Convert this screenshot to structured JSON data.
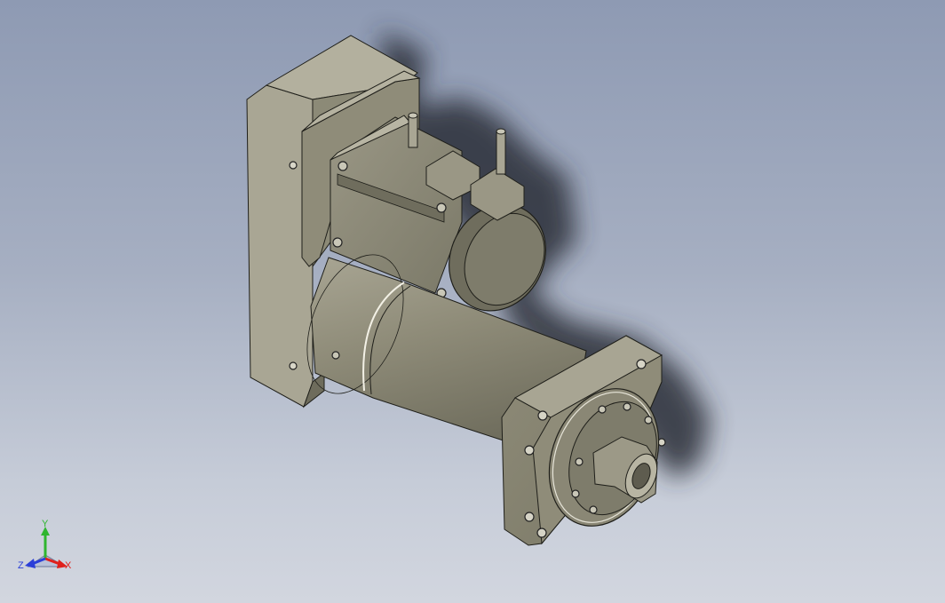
{
  "viewport": {
    "background_top": "#8e9ab3",
    "background_bottom": "#d2d6df",
    "part_color": "#8d8a78"
  },
  "triad": {
    "x_label": "X",
    "y_label": "Y",
    "z_label": "Z",
    "x_color": "#e0201c",
    "y_color": "#2fb52f",
    "z_color": "#2b3fd8"
  }
}
